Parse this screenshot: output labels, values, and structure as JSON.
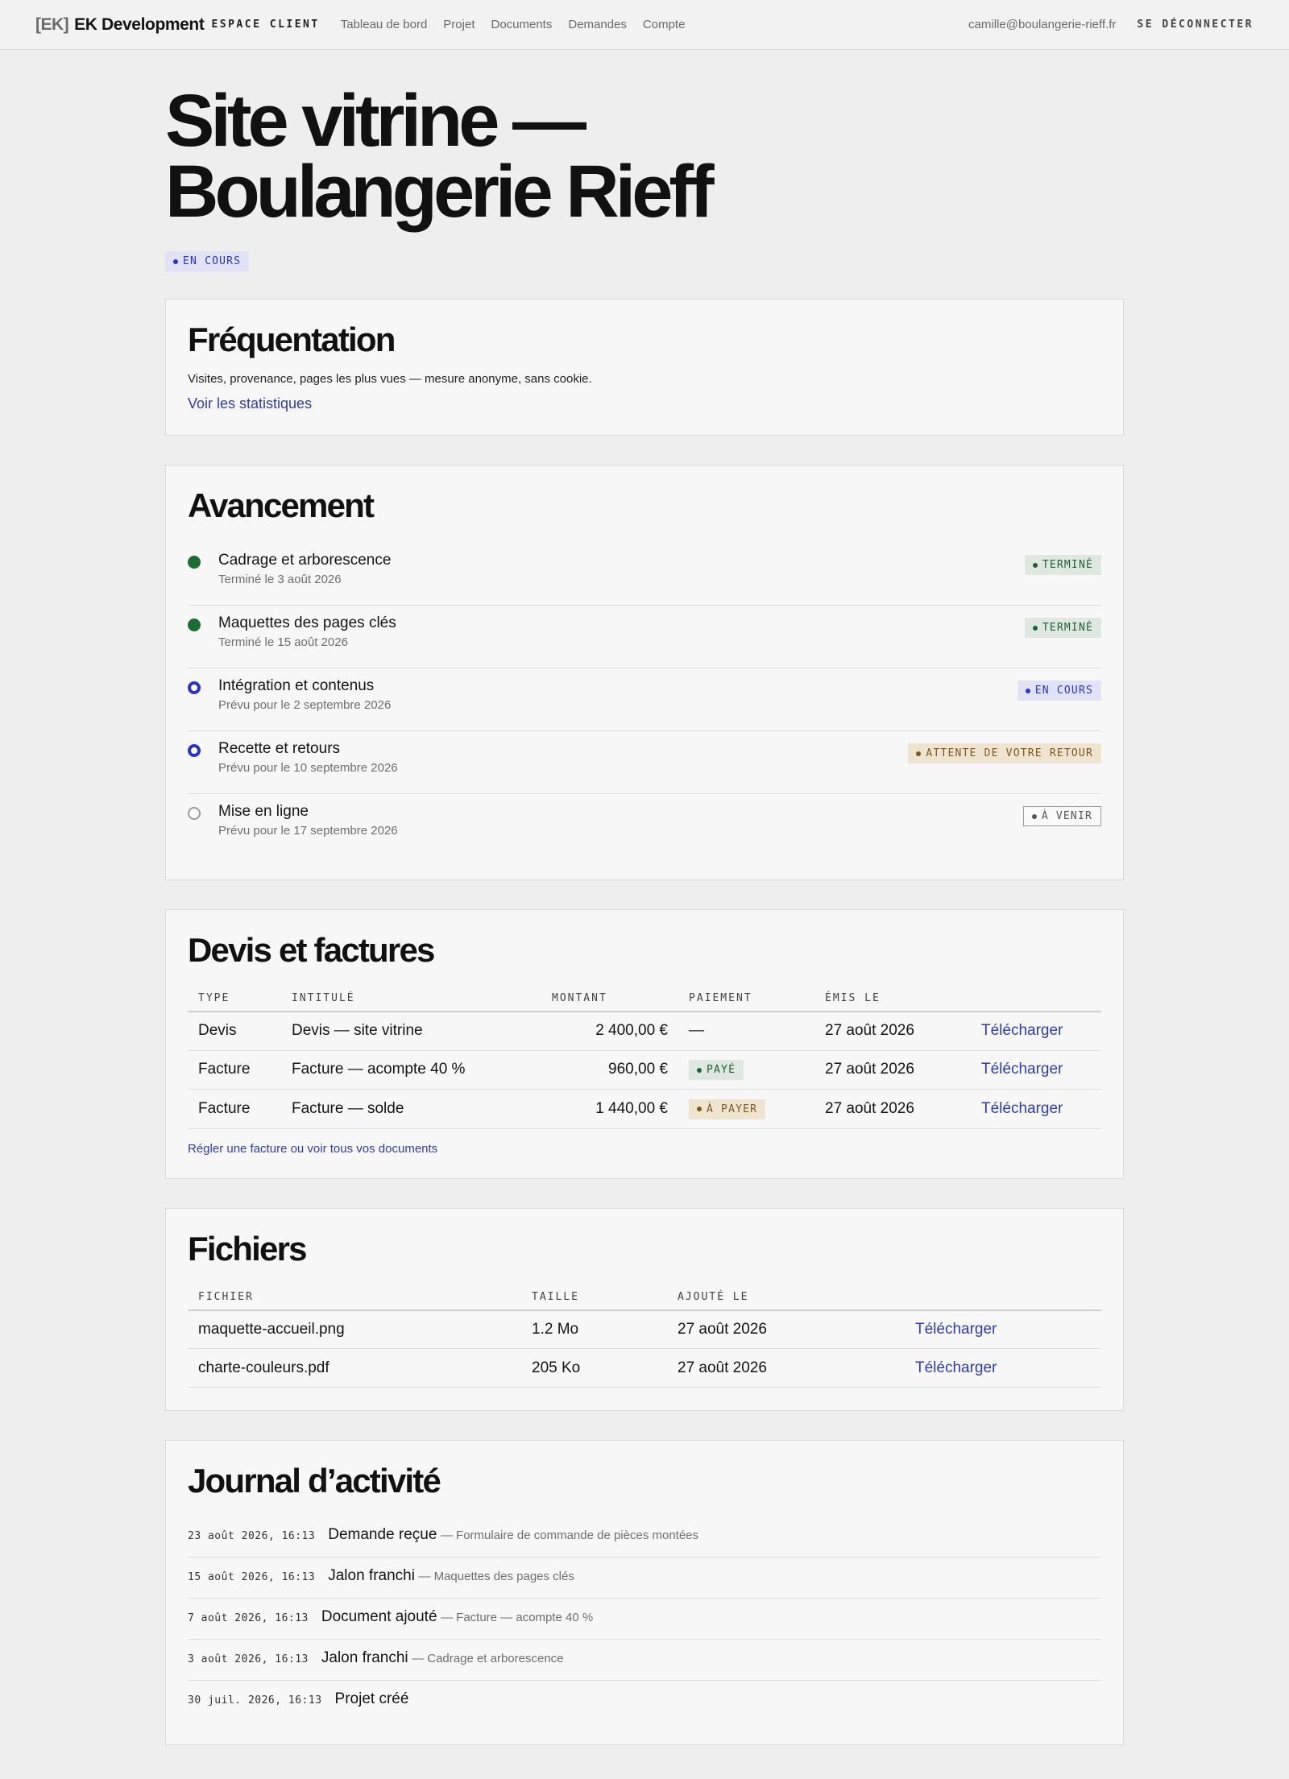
{
  "header": {
    "brand_mark": "[EK]",
    "brand_name": "EK Development",
    "brand_space": "ESPACE CLIENT",
    "nav": [
      {
        "label": "Tableau de bord"
      },
      {
        "label": "Projet"
      },
      {
        "label": "Documents"
      },
      {
        "label": "Demandes"
      },
      {
        "label": "Compte"
      }
    ],
    "user_email": "camille@boulangerie-rieff.fr",
    "logout_label": "SE DÉCONNECTER"
  },
  "project": {
    "title": "Site vitrine — Boulangerie Rieff",
    "status": "EN COURS"
  },
  "frequentation": {
    "title": "Fréquentation",
    "description": "Visites, provenance, pages les plus vues — mesure anonyme, sans cookie.",
    "link": "Voir les statistiques"
  },
  "avancement": {
    "title": "Avancement",
    "steps": [
      {
        "title": "Cadrage et arborescence",
        "sub": "Terminé le 3 août 2026",
        "badge": "TERMINÉ"
      },
      {
        "title": "Maquettes des pages clés",
        "sub": "Terminé le 15 août 2026",
        "badge": "TERMINÉ"
      },
      {
        "title": "Intégration et contenus",
        "sub": "Prévu pour le 2 septembre 2026",
        "badge": "EN COURS"
      },
      {
        "title": "Recette et retours",
        "sub": "Prévu pour le 10 septembre 2026",
        "badge": "ATTENTE DE VOTRE RETOUR"
      },
      {
        "title": "Mise en ligne",
        "sub": "Prévu pour le 17 septembre 2026",
        "badge": "À VENIR"
      }
    ]
  },
  "billing": {
    "title": "Devis et factures",
    "columns": {
      "type": "TYPE",
      "label": "INTITULÉ",
      "amount": "MONTANT",
      "payment": "PAIEMENT",
      "date": "ÉMIS LE"
    },
    "rows": [
      {
        "type": "Devis",
        "label": "Devis — site vitrine",
        "amount": "2 400,00 €",
        "payment": "—",
        "date": "27 août 2026",
        "action": "Télécharger"
      },
      {
        "type": "Facture",
        "label": "Facture — acompte 40 %",
        "amount": "960,00 €",
        "payment": "PAYÉ",
        "date": "27 août 2026",
        "action": "Télécharger"
      },
      {
        "type": "Facture",
        "label": "Facture — solde",
        "amount": "1 440,00 €",
        "payment": "À PAYER",
        "date": "27 août 2026",
        "action": "Télécharger"
      }
    ],
    "footer_link": "Régler une facture ou voir tous vos documents"
  },
  "files": {
    "title": "Fichiers",
    "columns": {
      "name": "FICHIER",
      "size": "TAILLE",
      "date": "AJOUTÉ LE"
    },
    "rows": [
      {
        "name": "maquette-accueil.png",
        "size": "1.2 Mo",
        "date": "27 août 2026",
        "action": "Télécharger"
      },
      {
        "name": "charte-couleurs.pdf",
        "size": "205 Ko",
        "date": "27 août 2026",
        "action": "Télécharger"
      }
    ]
  },
  "journal": {
    "title": "Journal d’activité",
    "entries": [
      {
        "date": "23 août 2026, 16:13",
        "title": "Demande reçue",
        "detail": "— Formulaire de commande de pièces montées"
      },
      {
        "date": "15 août 2026, 16:13",
        "title": "Jalon franchi",
        "detail": "— Maquettes des pages clés"
      },
      {
        "date": "7 août 2026, 16:13",
        "title": "Document ajouté",
        "detail": "— Facture — acompte 40 %"
      },
      {
        "date": "3 août 2026, 16:13",
        "title": "Jalon franchi",
        "detail": "— Cadrage et arborescence"
      },
      {
        "date": "30 juil. 2026, 16:13",
        "title": "Projet créé",
        "detail": ""
      }
    ]
  }
}
